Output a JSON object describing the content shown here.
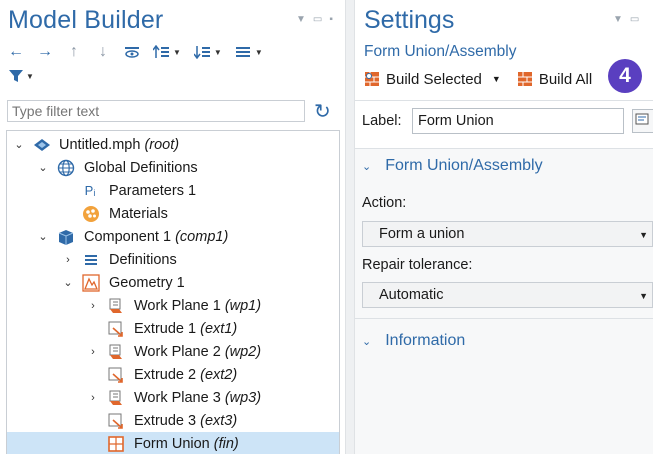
{
  "model_builder": {
    "title": "Model Builder",
    "filter_placeholder": "Type filter text",
    "tree": [
      {
        "label": "Untitled.mph",
        "suffix": "(root)",
        "icon": "mph-file-icon",
        "expanded": true
      },
      {
        "label": "Global Definitions",
        "suffix": "",
        "icon": "globe-icon",
        "expanded": true
      },
      {
        "label": "Parameters 1",
        "suffix": "",
        "icon": "parameters-icon"
      },
      {
        "label": "Materials",
        "suffix": "",
        "icon": "materials-icon"
      },
      {
        "label": "Component 1",
        "suffix": "(comp1)",
        "icon": "component-icon",
        "expanded": true
      },
      {
        "label": "Definitions",
        "suffix": "",
        "icon": "definitions-icon",
        "expanded": false
      },
      {
        "label": "Geometry 1",
        "suffix": "",
        "icon": "geometry-icon",
        "expanded": true
      },
      {
        "label": "Work Plane 1",
        "suffix": "(wp1)",
        "icon": "work-plane-icon",
        "expanded": false
      },
      {
        "label": "Extrude 1",
        "suffix": "(ext1)",
        "icon": "extrude-icon"
      },
      {
        "label": "Work Plane 2",
        "suffix": "(wp2)",
        "icon": "work-plane-icon",
        "expanded": false
      },
      {
        "label": "Extrude 2",
        "suffix": "(ext2)",
        "icon": "extrude-icon"
      },
      {
        "label": "Work Plane 3",
        "suffix": "(wp3)",
        "icon": "work-plane-icon",
        "expanded": false
      },
      {
        "label": "Extrude 3",
        "suffix": "(ext3)",
        "icon": "extrude-icon"
      },
      {
        "label": "Form Union",
        "suffix": "(fin)",
        "icon": "form-union-icon",
        "selected": true
      }
    ]
  },
  "settings": {
    "title": "Settings",
    "subtitle": "Form Union/Assembly",
    "build_selected": "Build Selected",
    "build_all": "Build All",
    "step_badge": "4",
    "label_caption": "Label:",
    "label_value": "Form Union",
    "section_main": "Form Union/Assembly",
    "action_label": "Action:",
    "action_value": "Form a union",
    "repair_label": "Repair tolerance:",
    "repair_value": "Automatic",
    "section_info": "Information"
  },
  "colors": {
    "accent": "#2f6aa8",
    "selection": "#cde4f7",
    "badge": "#5a3fc0",
    "geometry_orange": "#e0672c"
  }
}
